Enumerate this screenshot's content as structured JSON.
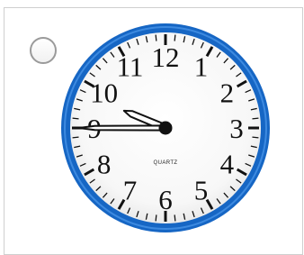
{
  "answer_option": {
    "selected": false,
    "clock": {
      "brand": "QUARTZ",
      "numerals": [
        "12",
        "1",
        "2",
        "3",
        "4",
        "5",
        "6",
        "7",
        "8",
        "9",
        "10",
        "11"
      ],
      "time": {
        "hour": 9,
        "minute": 45
      },
      "colors": {
        "rim": "#1666c4",
        "face": "#ffffff",
        "hands": "#111111"
      }
    }
  }
}
